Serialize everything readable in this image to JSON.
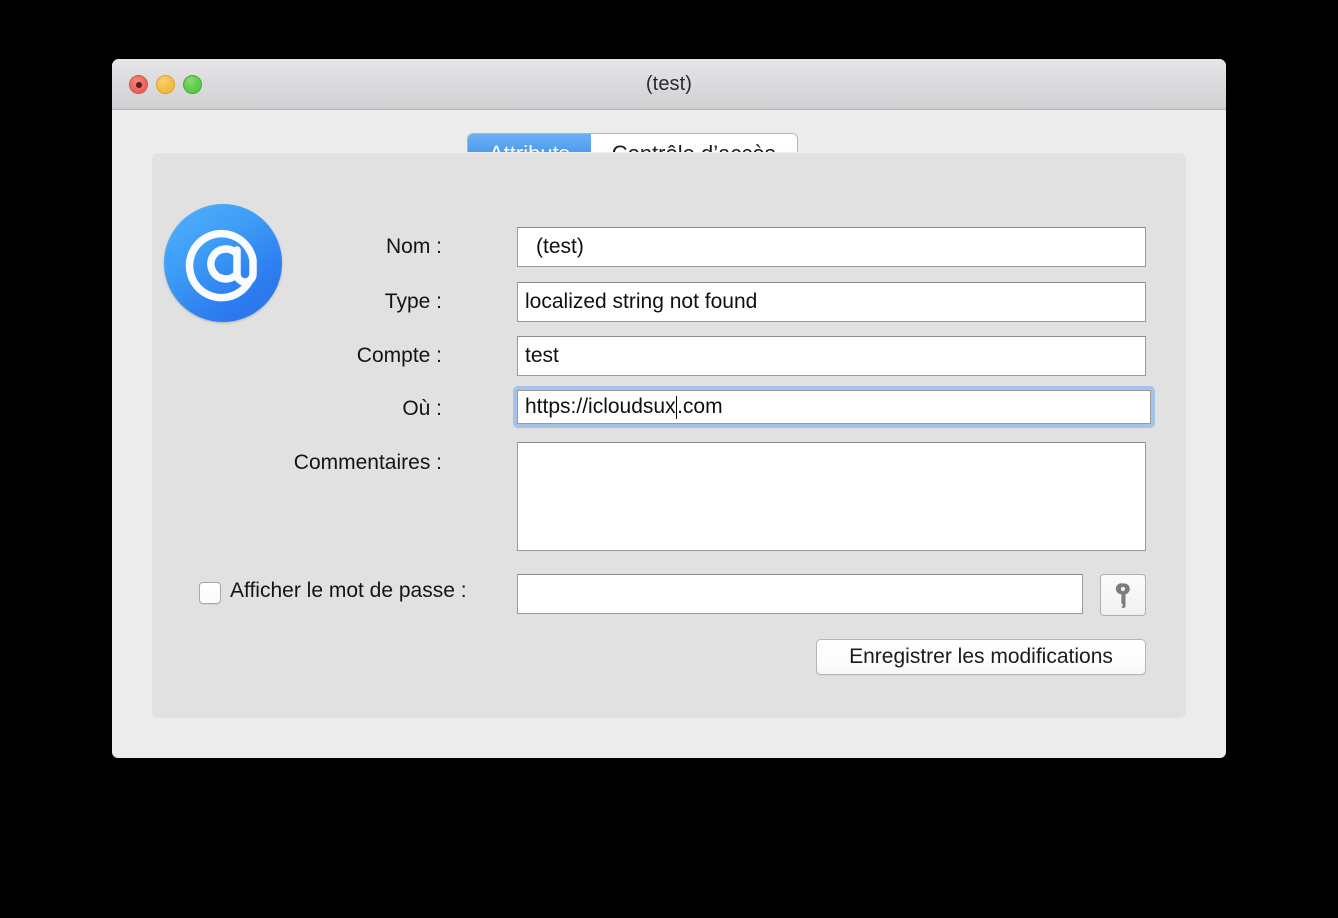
{
  "window": {
    "title": "(test)",
    "traffic_lights": {
      "close": "close-button",
      "minimize": "minimize-button",
      "maximize": "maximize-button"
    }
  },
  "tabs": [
    {
      "label": "Attributs",
      "selected": true
    },
    {
      "label": "Contrôle d’accès",
      "selected": false
    }
  ],
  "icon": {
    "name": "at-sign-icon",
    "glyph": "@",
    "color": "#2d7df0"
  },
  "form": {
    "fields": [
      {
        "label": "Nom :",
        "value": "(test)"
      },
      {
        "label": "Type :",
        "value": "localized string not found"
      },
      {
        "label": "Compte :",
        "value": "test"
      },
      {
        "label": "Où :",
        "value": "https://icloudsux.com",
        "focused": true
      }
    ],
    "comments": {
      "label": "Commentaires :",
      "value": ""
    },
    "show_password": {
      "label": "Afficher le mot de passe :",
      "checked": false,
      "value": ""
    },
    "key_button": {
      "name": "key-icon"
    },
    "save_button": {
      "label": "Enregistrer les modifications"
    }
  },
  "ou_value_parts": {
    "before_caret": "https://icloudsux",
    "after_caret": ".com"
  },
  "colors": {
    "accent": "#2f80e8",
    "focus_ring": "#a3c3e9",
    "window_bg": "#ececec",
    "panel_bg": "#e1e1e1"
  }
}
